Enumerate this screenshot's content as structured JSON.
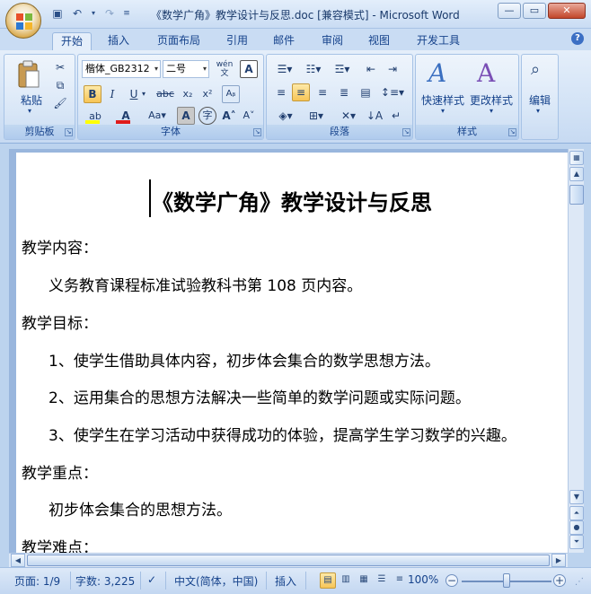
{
  "window": {
    "title": "《数学广角》教学设计与反思.doc [兼容模式] - Microsoft Word"
  },
  "tabs": [
    {
      "label": "开始",
      "active": true
    },
    {
      "label": "插入"
    },
    {
      "label": "页面布局"
    },
    {
      "label": "引用"
    },
    {
      "label": "邮件"
    },
    {
      "label": "审阅"
    },
    {
      "label": "视图"
    },
    {
      "label": "开发工具"
    }
  ],
  "ribbon": {
    "clipboard": {
      "label": "剪贴板",
      "paste_label": "粘贴"
    },
    "font": {
      "label": "字体",
      "font_name": "楷体_GB2312",
      "font_size": "二号",
      "wen_label": "wén"
    },
    "paragraph": {
      "label": "段落"
    },
    "styles": {
      "label": "样式",
      "quick_styles": "快速样式",
      "change_styles": "更改样式"
    },
    "editing": {
      "label": "编辑"
    }
  },
  "document": {
    "title": "《数学广角》教学设计与反思",
    "paragraphs": [
      {
        "text": "教学内容：",
        "indent": false
      },
      {
        "text": "义务教育课程标准试验教科书第 108 页内容。",
        "indent": true
      },
      {
        "text": "教学目标：",
        "indent": false
      },
      {
        "text": "1、使学生借助具体内容，初步体会集合的数学思想方法。",
        "indent": true
      },
      {
        "text": "2、运用集合的思想方法解决一些简单的数学问题或实际问题。",
        "indent": true
      },
      {
        "text": "3、使学生在学习活动中获得成功的体验，提高学生学习数学的兴趣。",
        "indent": true
      },
      {
        "text": "教学重点：",
        "indent": false
      },
      {
        "text": "初步体会集合的思想方法。",
        "indent": true
      },
      {
        "text": "教学难点：",
        "indent": false
      }
    ]
  },
  "status": {
    "page": "页面: 1/9",
    "words": "字数: 3,225",
    "language": "中文(简体，中国)",
    "mode": "插入",
    "zoom": "100%"
  },
  "colors": {
    "accent": "#15428b",
    "ribbon_bg": "#d3e3f6",
    "selected": "#f7c557"
  }
}
